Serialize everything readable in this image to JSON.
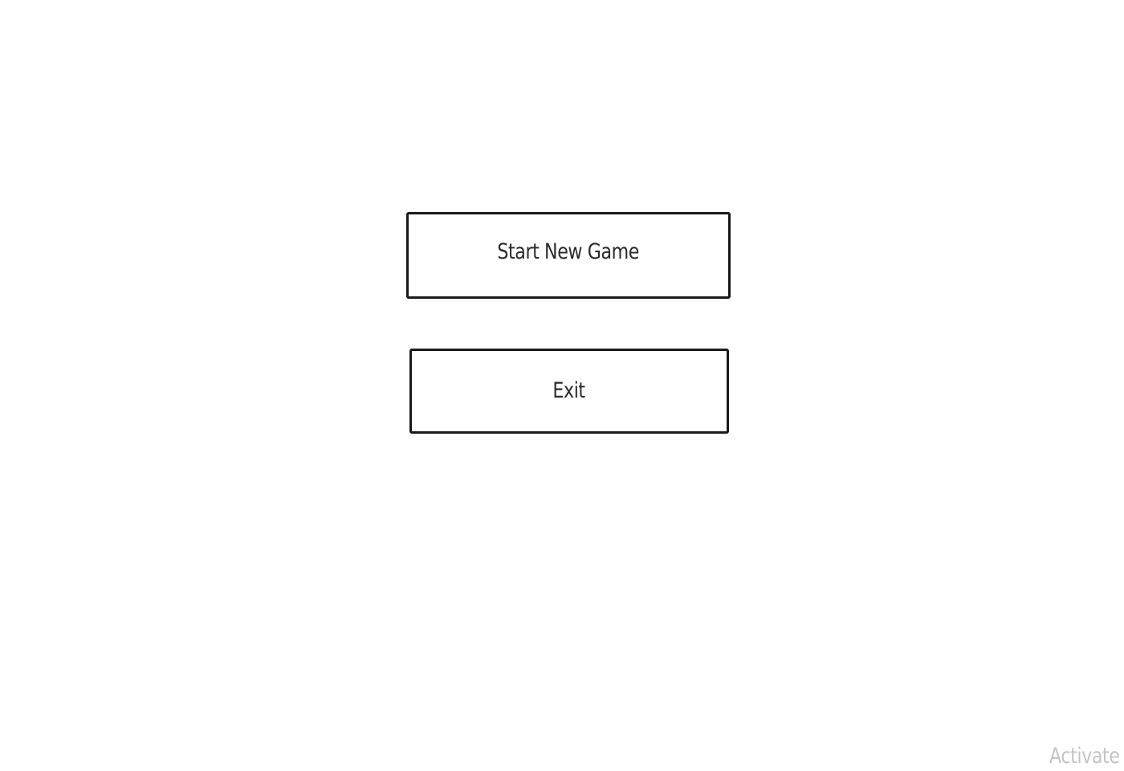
{
  "menu": {
    "start_label": "Start New Game",
    "exit_label": "Exit"
  },
  "watermark": {
    "text": "Activate"
  },
  "colors": {
    "background": "#ffffff",
    "button_border": "#1a1a1a",
    "button_text": "#2a2a2a",
    "watermark_text": "#c4c4c4"
  }
}
